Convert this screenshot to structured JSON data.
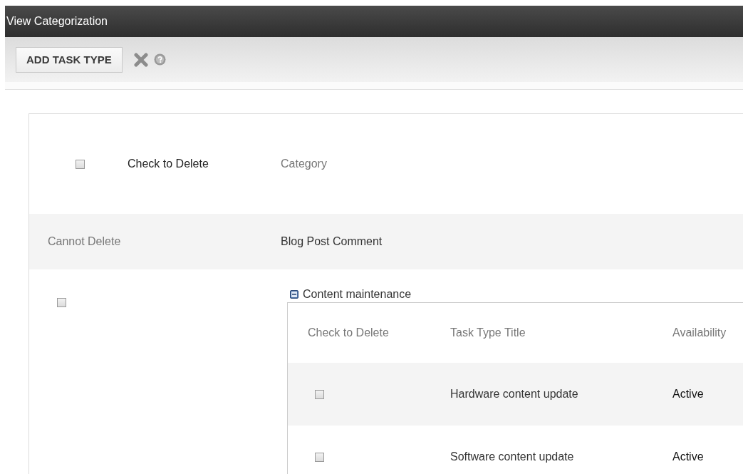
{
  "window": {
    "title": "View Categorization"
  },
  "toolbar": {
    "add_button": "ADD TASK TYPE"
  },
  "table": {
    "header": {
      "checked": false,
      "check_label": "Check to Delete",
      "category_label": "Category"
    },
    "rows": [
      {
        "kind": "locked",
        "delete_label": "Cannot Delete",
        "category": "Blog Post Comment"
      },
      {
        "kind": "group",
        "checked": false,
        "category": "Content maintenance",
        "expanded": true,
        "subtable": {
          "columns": [
            "Check to Delete",
            "Task Type Title",
            "Availability"
          ],
          "rows": [
            {
              "checked": false,
              "title": "Hardware content update",
              "availability": "Active"
            },
            {
              "checked": false,
              "title": "Software content update",
              "availability": "Active"
            }
          ]
        }
      }
    ]
  }
}
